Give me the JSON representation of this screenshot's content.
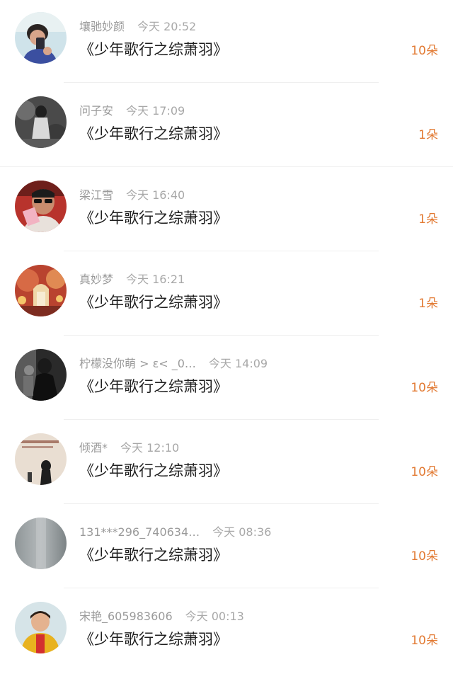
{
  "gifts": [
    {
      "name": "壤驰妙颜",
      "time": "今天 20:52",
      "title": "《少年歌行之综萧羽》",
      "count": "10朵"
    },
    {
      "name": "问子安",
      "time": "今天 17:09",
      "title": "《少年歌行之综萧羽》",
      "count": "1朵"
    },
    {
      "name": "梁江雪",
      "time": "今天 16:40",
      "title": "《少年歌行之综萧羽》",
      "count": "1朵"
    },
    {
      "name": "真妙梦",
      "time": "今天 16:21",
      "title": "《少年歌行之综萧羽》",
      "count": "1朵"
    },
    {
      "name": "柠檬没你萌 > ε< _0…",
      "time": "今天 14:09",
      "title": "《少年歌行之综萧羽》",
      "count": "10朵"
    },
    {
      "name": "倾酒*",
      "time": "今天 12:10",
      "title": "《少年歌行之综萧羽》",
      "count": "10朵"
    },
    {
      "name": "131***296_740634…",
      "time": "今天 08:36",
      "title": "《少年歌行之综萧羽》",
      "count": "10朵"
    },
    {
      "name": "宋艳_605983606",
      "time": "今天 00:13",
      "title": "《少年歌行之综萧羽》",
      "count": "10朵"
    }
  ],
  "colors": {
    "accent": "#e27a33",
    "name_text": "#9a9a9a",
    "title_text": "#1f1f1f",
    "divider": "#efefef"
  }
}
